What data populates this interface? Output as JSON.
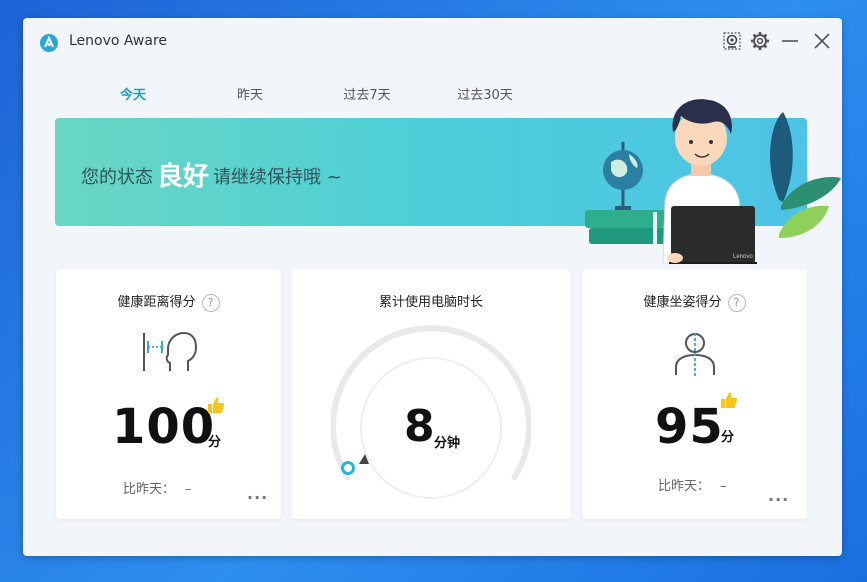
{
  "app": {
    "title": "Lenovo Aware"
  },
  "titlebar": {
    "icons": [
      "camera-icon",
      "settings-icon",
      "minimize-icon",
      "close-icon"
    ]
  },
  "tabs": [
    {
      "label": "今天",
      "active": true
    },
    {
      "label": "昨天",
      "active": false
    },
    {
      "label": "过去7天",
      "active": false
    },
    {
      "label": "过去30天",
      "active": false
    }
  ],
  "banner": {
    "prefix": "您的状态",
    "status": "良好",
    "suffix": "请继续保持哦 ~",
    "laptop_brand": "Lenovo"
  },
  "cards": {
    "distance": {
      "title": "健康距离得分",
      "score": "100",
      "unit": "分",
      "compare_label": "比昨天：",
      "compare_value": "–",
      "more": "···"
    },
    "usage": {
      "title": "累计使用电脑时长",
      "value": "8",
      "unit": "分钟"
    },
    "posture": {
      "title": "健康坐姿得分",
      "score": "95",
      "unit": "分",
      "compare_label": "比昨天：",
      "compare_value": "–",
      "more": "···"
    }
  },
  "colors": {
    "accent": "#1aa0c4",
    "banner_start": "#6ad6c3",
    "banner_end": "#4dc3e6",
    "thumb": "#f5c518"
  }
}
